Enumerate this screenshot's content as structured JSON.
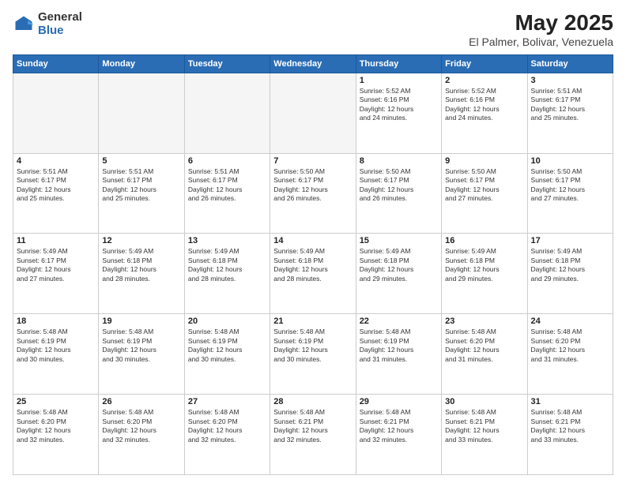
{
  "logo": {
    "general": "General",
    "blue": "Blue"
  },
  "title": "May 2025",
  "subtitle": "El Palmer, Bolivar, Venezuela",
  "days_header": [
    "Sunday",
    "Monday",
    "Tuesday",
    "Wednesday",
    "Thursday",
    "Friday",
    "Saturday"
  ],
  "weeks": [
    [
      {
        "day": "",
        "info": ""
      },
      {
        "day": "",
        "info": ""
      },
      {
        "day": "",
        "info": ""
      },
      {
        "day": "",
        "info": ""
      },
      {
        "day": "1",
        "info": "Sunrise: 5:52 AM\nSunset: 6:16 PM\nDaylight: 12 hours\nand 24 minutes."
      },
      {
        "day": "2",
        "info": "Sunrise: 5:52 AM\nSunset: 6:16 PM\nDaylight: 12 hours\nand 24 minutes."
      },
      {
        "day": "3",
        "info": "Sunrise: 5:51 AM\nSunset: 6:17 PM\nDaylight: 12 hours\nand 25 minutes."
      }
    ],
    [
      {
        "day": "4",
        "info": "Sunrise: 5:51 AM\nSunset: 6:17 PM\nDaylight: 12 hours\nand 25 minutes."
      },
      {
        "day": "5",
        "info": "Sunrise: 5:51 AM\nSunset: 6:17 PM\nDaylight: 12 hours\nand 25 minutes."
      },
      {
        "day": "6",
        "info": "Sunrise: 5:51 AM\nSunset: 6:17 PM\nDaylight: 12 hours\nand 26 minutes."
      },
      {
        "day": "7",
        "info": "Sunrise: 5:50 AM\nSunset: 6:17 PM\nDaylight: 12 hours\nand 26 minutes."
      },
      {
        "day": "8",
        "info": "Sunrise: 5:50 AM\nSunset: 6:17 PM\nDaylight: 12 hours\nand 26 minutes."
      },
      {
        "day": "9",
        "info": "Sunrise: 5:50 AM\nSunset: 6:17 PM\nDaylight: 12 hours\nand 27 minutes."
      },
      {
        "day": "10",
        "info": "Sunrise: 5:50 AM\nSunset: 6:17 PM\nDaylight: 12 hours\nand 27 minutes."
      }
    ],
    [
      {
        "day": "11",
        "info": "Sunrise: 5:49 AM\nSunset: 6:17 PM\nDaylight: 12 hours\nand 27 minutes."
      },
      {
        "day": "12",
        "info": "Sunrise: 5:49 AM\nSunset: 6:18 PM\nDaylight: 12 hours\nand 28 minutes."
      },
      {
        "day": "13",
        "info": "Sunrise: 5:49 AM\nSunset: 6:18 PM\nDaylight: 12 hours\nand 28 minutes."
      },
      {
        "day": "14",
        "info": "Sunrise: 5:49 AM\nSunset: 6:18 PM\nDaylight: 12 hours\nand 28 minutes."
      },
      {
        "day": "15",
        "info": "Sunrise: 5:49 AM\nSunset: 6:18 PM\nDaylight: 12 hours\nand 29 minutes."
      },
      {
        "day": "16",
        "info": "Sunrise: 5:49 AM\nSunset: 6:18 PM\nDaylight: 12 hours\nand 29 minutes."
      },
      {
        "day": "17",
        "info": "Sunrise: 5:49 AM\nSunset: 6:18 PM\nDaylight: 12 hours\nand 29 minutes."
      }
    ],
    [
      {
        "day": "18",
        "info": "Sunrise: 5:48 AM\nSunset: 6:19 PM\nDaylight: 12 hours\nand 30 minutes."
      },
      {
        "day": "19",
        "info": "Sunrise: 5:48 AM\nSunset: 6:19 PM\nDaylight: 12 hours\nand 30 minutes."
      },
      {
        "day": "20",
        "info": "Sunrise: 5:48 AM\nSunset: 6:19 PM\nDaylight: 12 hours\nand 30 minutes."
      },
      {
        "day": "21",
        "info": "Sunrise: 5:48 AM\nSunset: 6:19 PM\nDaylight: 12 hours\nand 30 minutes."
      },
      {
        "day": "22",
        "info": "Sunrise: 5:48 AM\nSunset: 6:19 PM\nDaylight: 12 hours\nand 31 minutes."
      },
      {
        "day": "23",
        "info": "Sunrise: 5:48 AM\nSunset: 6:20 PM\nDaylight: 12 hours\nand 31 minutes."
      },
      {
        "day": "24",
        "info": "Sunrise: 5:48 AM\nSunset: 6:20 PM\nDaylight: 12 hours\nand 31 minutes."
      }
    ],
    [
      {
        "day": "25",
        "info": "Sunrise: 5:48 AM\nSunset: 6:20 PM\nDaylight: 12 hours\nand 32 minutes."
      },
      {
        "day": "26",
        "info": "Sunrise: 5:48 AM\nSunset: 6:20 PM\nDaylight: 12 hours\nand 32 minutes."
      },
      {
        "day": "27",
        "info": "Sunrise: 5:48 AM\nSunset: 6:20 PM\nDaylight: 12 hours\nand 32 minutes."
      },
      {
        "day": "28",
        "info": "Sunrise: 5:48 AM\nSunset: 6:21 PM\nDaylight: 12 hours\nand 32 minutes."
      },
      {
        "day": "29",
        "info": "Sunrise: 5:48 AM\nSunset: 6:21 PM\nDaylight: 12 hours\nand 32 minutes."
      },
      {
        "day": "30",
        "info": "Sunrise: 5:48 AM\nSunset: 6:21 PM\nDaylight: 12 hours\nand 33 minutes."
      },
      {
        "day": "31",
        "info": "Sunrise: 5:48 AM\nSunset: 6:21 PM\nDaylight: 12 hours\nand 33 minutes."
      }
    ]
  ]
}
